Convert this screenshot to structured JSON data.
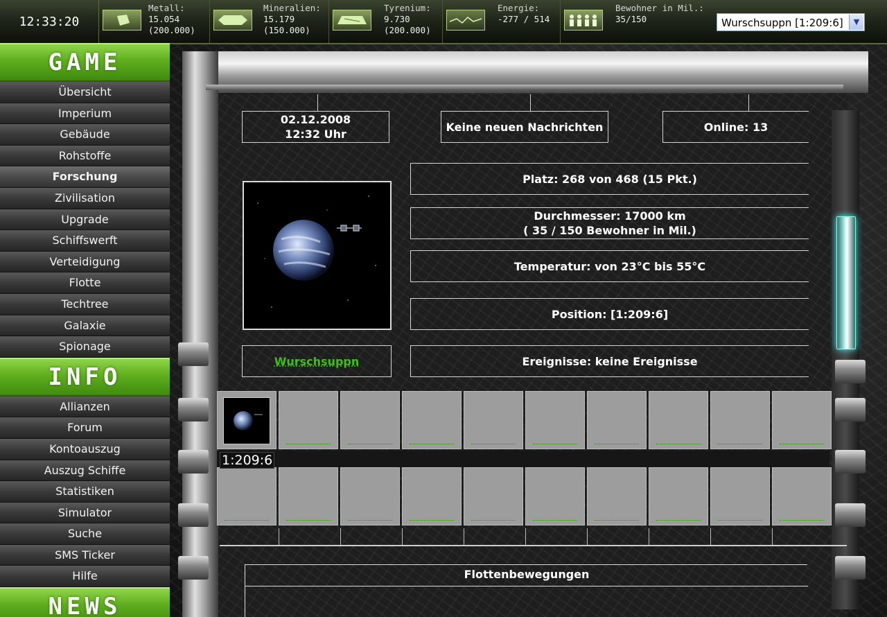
{
  "clock": "12:33:20",
  "resources": [
    {
      "name": "Metall:",
      "value": "15.054",
      "capacity": "(200.000)",
      "icon": "metal-icon"
    },
    {
      "name": "Mineralien:",
      "value": "15.179",
      "capacity": "(150.000)",
      "icon": "minerals-icon"
    },
    {
      "name": "Tyrenium:",
      "value": "9.730",
      "capacity": "(200.000)",
      "icon": "tyrenium-icon"
    },
    {
      "name": "Energie:",
      "value": "-277 / 514",
      "capacity": "",
      "icon": "energy-icon"
    },
    {
      "name": "Bewohner in Mil.:",
      "value": "35/150",
      "capacity": "",
      "icon": "population-icon"
    }
  ],
  "planet_select": {
    "value": "Wurschsuppn [1:209:6]"
  },
  "sidebar": {
    "game_title": "GAME",
    "game_items": [
      "Übersicht",
      "Imperium",
      "Gebäude",
      "Rohstoffe",
      "Forschung",
      "Zivilisation",
      "Upgrade",
      "Schiffswerft",
      "Verteidigung",
      "Flotte",
      "Techtree",
      "Galaxie",
      "Spionage"
    ],
    "active_item": "Forschung",
    "info_title": "INFO",
    "info_items": [
      "Allianzen",
      "Forum",
      "Kontoauszug",
      "Auszug Schiffe",
      "Statistiken",
      "Simulator",
      "Suche",
      "SMS Ticker",
      "Hilfe"
    ],
    "news_title": "NEWS"
  },
  "overview": {
    "date": "02.12.2008",
    "time": "12:32 Uhr",
    "messages": "Keine neuen Nachrichten",
    "online": "Online: 13",
    "rank": "Platz: 268 von 468 (15 Pkt.)",
    "diameter": "Durchmesser: 17000 km",
    "population": "( 35 / 150 Bewohner in Mil.)",
    "temperature": "Temperatur: von 23°C bis 55°C",
    "position": "Position: [1:209:6]",
    "planet_name": "Wurschsuppn",
    "events": "Ereignisse: keine Ereignisse"
  },
  "planet_strip": {
    "coord": "1:209:6"
  },
  "fleet": {
    "title": "Flottenbewegungen"
  },
  "colors": {
    "accent_green": "#5fae1e",
    "link_green": "#3fbf1a",
    "glow": "#bff7f1"
  }
}
